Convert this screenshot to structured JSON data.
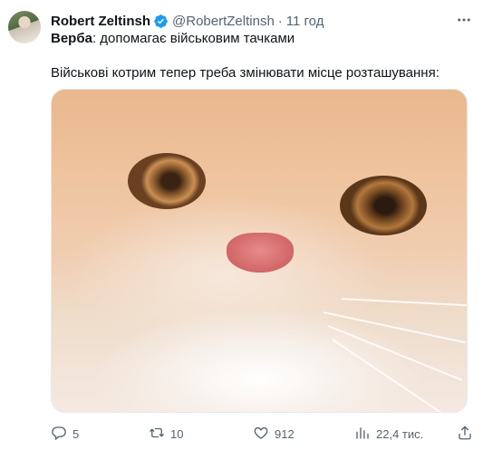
{
  "author": {
    "display_name": "Robert Zeltinsh",
    "handle": "@RobertZeltinsh",
    "separator": "·",
    "time": "11 год"
  },
  "tweet": {
    "name_bold": "Верба",
    "line1_rest": ": допомагає військовим тачками",
    "line2": "Військові котрим тепер треба змінювати місце розташування:"
  },
  "actions": {
    "replies": "5",
    "retweets": "10",
    "likes": "912",
    "views": "22,4 тис."
  },
  "icons": {
    "verified": "verified-badge-icon",
    "more": "more-icon",
    "reply": "reply-icon",
    "retweet": "retweet-icon",
    "like": "heart-icon",
    "views": "views-bar-chart-icon",
    "share": "share-icon"
  },
  "colors": {
    "text_primary": "#0f1419",
    "text_secondary": "#536471",
    "verified_blue": "#1d9bf0"
  }
}
